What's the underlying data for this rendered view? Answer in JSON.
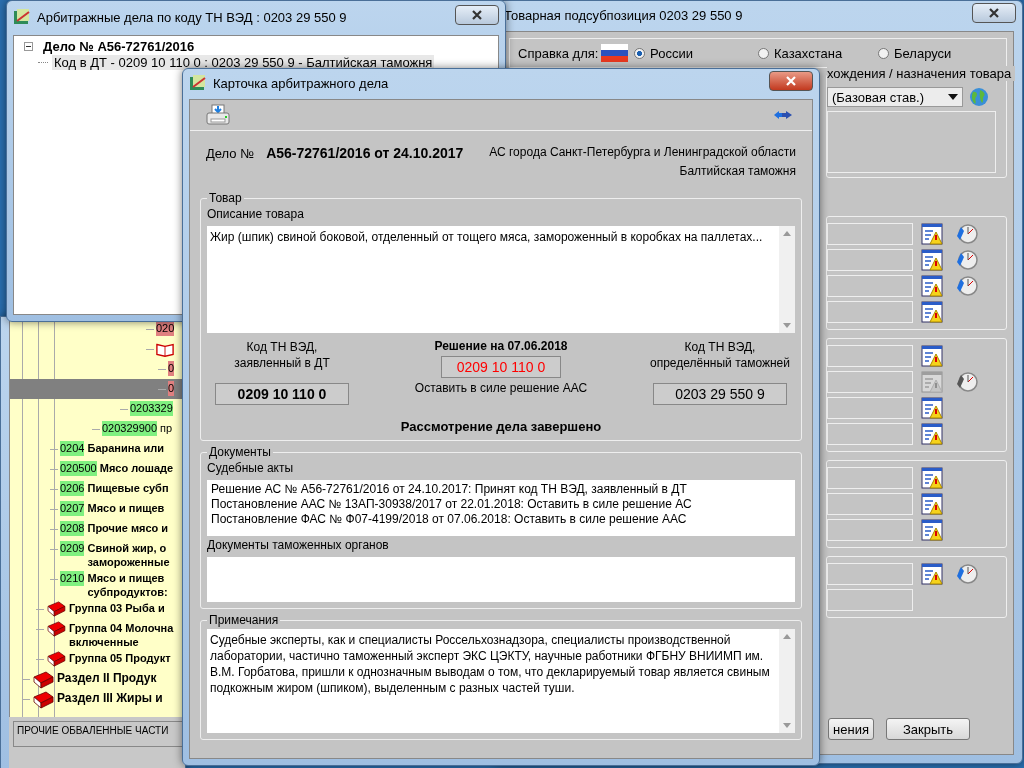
{
  "main_window": {
    "tree": [
      {
        "children": [
          {
            "children": [
              {
                "children": [
                  {
                    "children": [
                      {
                        "children": [
                          {
                            "kind": "code",
                            "code": "020",
                            "color": "#e08080",
                            "selected": false
                          },
                          {
                            "kind": "chapter",
                            "selected": false,
                            "children": [
                              {
                                "kind": "code",
                                "code": "0",
                                "color": "#e08080",
                                "selected": false
                              },
                              {
                                "kind": "code",
                                "code": "0",
                                "color": "#e08080",
                                "selected": true
                              }
                            ]
                          }
                        ]
                      },
                      {
                        "kind": "code",
                        "code": "0203329",
                        "color": "#80f080",
                        "selected": false
                      }
                    ]
                  },
                  {
                    "kind": "subcode",
                    "code": "020329900",
                    "text": [
                      "пр"
                    ],
                    "color": "#80f080",
                    "selected": false
                  }
                ]
              },
              {
                "kind": "code",
                "code": "0204",
                "text": [
                  "Баранина или"
                ],
                "color": "#80f080",
                "selected": false
              },
              {
                "kind": "code",
                "code": "020500",
                "text": [
                  "Мясо лошаде"
                ],
                "color": "#80f080",
                "selected": false
              },
              {
                "kind": "code",
                "code": "0206",
                "text": [
                  "Пищевые субп"
                ],
                "color": "#80f080",
                "selected": false
              },
              {
                "kind": "code",
                "code": "0207",
                "text": [
                  "Мясо и пищев"
                ],
                "color": "#80f080",
                "selected": false
              },
              {
                "kind": "code",
                "code": "0208",
                "text": [
                  "Прочие мясо и"
                ],
                "color": "#80f080",
                "selected": false
              },
              {
                "kind": "code",
                "code": "0209",
                "text": [
                  "Свиной жир, о",
                  "замороженные"
                ],
                "color": "#80f080",
                "selected": false
              },
              {
                "kind": "code",
                "code": "0210",
                "text": [
                  "Мясо и пищев",
                  "субпродуктов:"
                ],
                "color": "#80f080",
                "selected": false
              }
            ]
          },
          {
            "kind": "group",
            "text": [
              "Группа 03 Рыба и"
            ],
            "selected": false
          },
          {
            "kind": "group",
            "text": [
              "Группа 04 Молочна",
              "включенные"
            ],
            "selected": false
          },
          {
            "kind": "group",
            "text": [
              "Группа 05 Продукт"
            ],
            "selected": false
          }
        ]
      },
      {
        "kind": "section",
        "text": [
          "Раздел II Продук"
        ],
        "selected": false
      },
      {
        "kind": "section",
        "text": [
          "Раздел III Жиры и"
        ],
        "selected": false
      }
    ],
    "status_bar": "ПРОЧИЕ ОБВАЛЕННЫЕ ЧАСТИ"
  },
  "subposition_window": {
    "title": "Товарная подсубпозиция 0203 29 550 9",
    "reference_label": "Справка для:",
    "countries": [
      {
        "label": "России",
        "selected": true,
        "flag": true
      },
      {
        "label": "Казахстана",
        "selected": false,
        "flag": false
      },
      {
        "label": "Беларуси",
        "selected": false,
        "flag": false
      }
    ],
    "origin_group": {
      "legend": "хождения / назначения товара",
      "dropdown": "(Базовая став.)"
    },
    "field_groups": [
      {
        "rows": [
          {
            "check_icon": {
              "disabled": false
            },
            "clock": {
              "disabled": false
            }
          },
          {
            "check_icon": {
              "disabled": false
            },
            "clock": {
              "disabled": false
            }
          },
          {
            "check_icon": {
              "disabled": false
            },
            "clock": {
              "disabled": false
            }
          },
          {
            "check_icon": {
              "disabled": false
            }
          }
        ]
      },
      {
        "rows": [
          {
            "check_icon": {
              "disabled": false
            }
          },
          {
            "check_icon": {
              "disabled": true
            },
            "clock": {
              "disabled": true
            }
          },
          {
            "check_icon": {
              "disabled": false
            }
          },
          {
            "check_icon": {
              "disabled": false
            }
          }
        ]
      },
      {
        "rows": [
          {
            "check_icon": {
              "disabled": false
            }
          },
          {
            "check_icon": {
              "disabled": false
            }
          },
          {
            "check_icon": {
              "disabled": false
            }
          }
        ]
      },
      {
        "rows": [
          {
            "check_icon": {
              "disabled": false
            },
            "clock": {
              "disabled": false
            }
          },
          {}
        ]
      }
    ],
    "buttons": [
      "нения",
      "Закрыть"
    ]
  },
  "cases_window": {
    "title": "Арбитражные дела по коду ТН ВЭД : 0203 29 550 9",
    "tree": [
      {
        "label": "Дело № А56-72761/2016",
        "expanded": true,
        "selected": false,
        "children": [
          {
            "label": "Код в ДТ - 0209 10 110 0 : 0203 29 550 9 - Балтийская таможня",
            "selected": true
          }
        ]
      }
    ]
  },
  "case_card": {
    "title": "Карточка арбитражного дела",
    "case_label": "Дело №",
    "case_number": "А56-72761/2016 от 24.10.2017",
    "court": "АС города Санкт-Петербурга и Ленинградской области",
    "customs": "Балтийская таможня",
    "goods": {
      "legend": "Товар",
      "description_label": "Описание товара",
      "description": "Жир (шпик) свиной боковой, отделенный от тощего мяса, замороженный в коробках на паллетах...",
      "declared": {
        "label": "Код ТН ВЭД, заявленный в ДТ",
        "code": "0209 10 110 0"
      },
      "decision": {
        "label": "Решение на 07.06.2018",
        "code": "0209 10 110 0",
        "note": "Оставить в силе решение ААС"
      },
      "customs_code": {
        "label": "Код ТН ВЭД, определённый таможней",
        "code": "0203 29 550 9"
      },
      "status": "Рассмотрение дела завершено"
    },
    "documents": {
      "legend": "Документы",
      "court_acts_label": "Судебные акты",
      "court_acts": [
        "Решение АС № А56-72761/2016 от 24.10.2017: Принят код ТН ВЭД, заявленный в ДТ",
        "Постановление ААС № 13АП-30938/2017 от 22.01.2018: Оставить в силе решение АС",
        "Постановление ФАС № Ф07-4199/2018 от 07.06.2018: Оставить в силе решение ААС"
      ],
      "customs_docs_label": "Документы таможенных органов"
    },
    "notes": {
      "legend": "Примечания",
      "text": "Судебные эксперты, как и специалисты Россельхознадзора, специалисты производственной лаборатории, частично таможенный эксперт ЭКС ЦЭКТУ, научные работники ФГБНУ ВНИИМП им. В.М. Горбатова, пришли к однозначным выводам о том, что декларируемый товар является свиным подкожным жиром (шпиком), выделенным с разных частей туши."
    }
  }
}
